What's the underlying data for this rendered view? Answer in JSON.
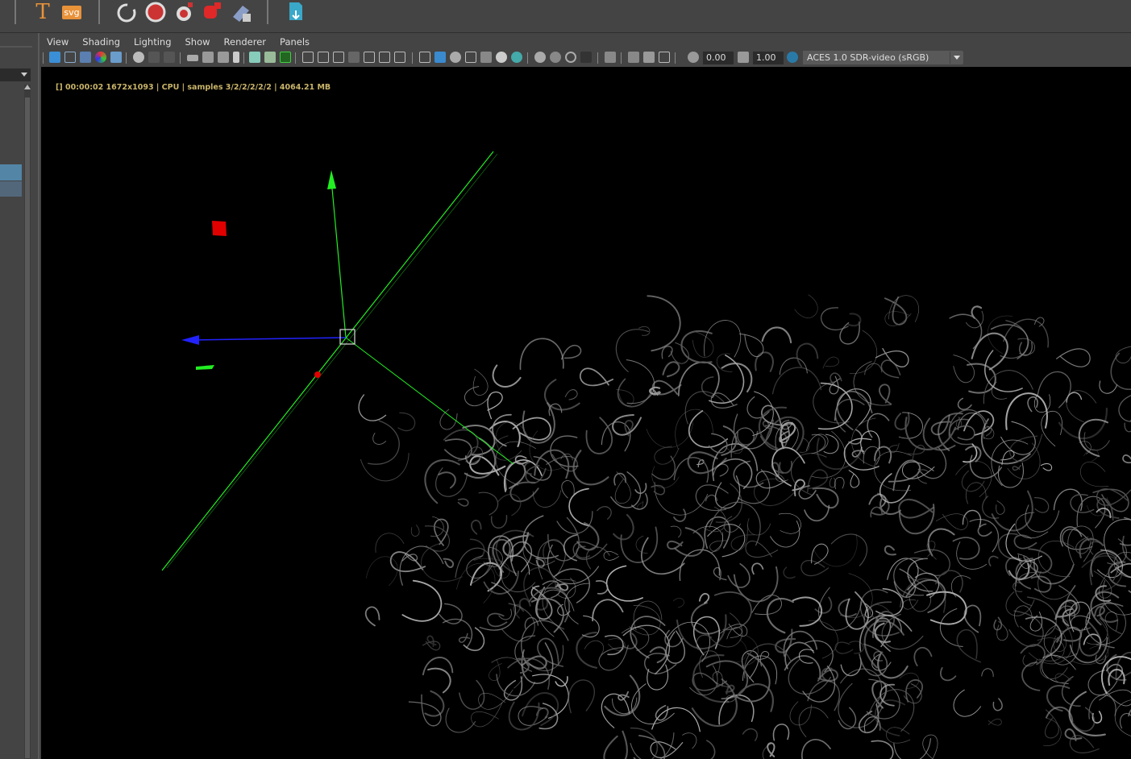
{
  "shelf": {
    "icons": [
      "text-tool-icon",
      "svg-tool-icon",
      "loop-icon",
      "circle-icon",
      "bomb-icon",
      "red-shape-icon",
      "paint-icon",
      "export-icon"
    ],
    "text_icon_label": "T",
    "svg_icon_label": "svg"
  },
  "panel": {
    "menu": [
      "View",
      "Shading",
      "Lighting",
      "Show",
      "Renderer",
      "Panels"
    ],
    "toolbar": {
      "exposure_value": "0.00",
      "gamma_value": "1.00",
      "color_space": "ACES 1.0 SDR-video (sRGB)"
    }
  },
  "viewport": {
    "hud_text": "[] 00:00:02 1672x1093 | CPU | samples 3/2/2/2/2/2 | 4064.21 MB"
  },
  "colors": {
    "accent_selection": "#5285a6",
    "hud": "#c9b46a",
    "axis_green": "#22ee22",
    "axis_blue": "#2222ff",
    "marker_red": "#e00000"
  }
}
